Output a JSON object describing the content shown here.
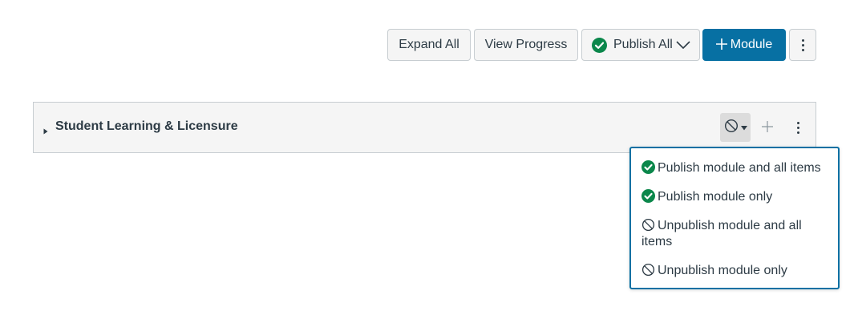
{
  "toolbar": {
    "expand_all": "Expand All",
    "view_progress": "View Progress",
    "publish_all": "Publish All",
    "module": "Module"
  },
  "module": {
    "title": "Student Learning & Licensure",
    "publish_state": "unpublished"
  },
  "publish_menu": {
    "items": [
      {
        "label": "Publish module and all items",
        "icon": "check-circle-icon"
      },
      {
        "label": "Publish module only",
        "icon": "check-circle-icon"
      },
      {
        "label": "Unpublish module and all items",
        "icon": "unpublished-icon"
      },
      {
        "label": "Unpublish module only",
        "icon": "unpublished-icon"
      }
    ]
  },
  "colors": {
    "primary": "#0770a3",
    "success": "#0b874b",
    "text": "#2d3b45",
    "border": "#c7cdd1",
    "button_bg": "#f5f5f5"
  }
}
